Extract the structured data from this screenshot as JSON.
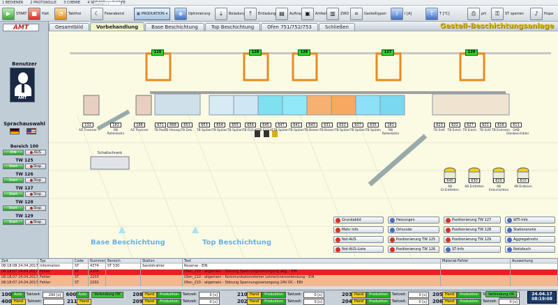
{
  "menu": [
    "1 BEDIENER",
    "2 PROTOKOLLE",
    "3 CHEMIE",
    "4 SERVICE",
    "5 HILFE"
  ],
  "search_placeholder": "Suchen / F",
  "toolbar": {
    "start": "START",
    "stop": "Halt",
    "takt": "Taktfrei",
    "feier": "Feierabend",
    "produktion": "PRODUKTION",
    "optim": "Optimierung",
    "belad": "Beladung",
    "entlad": "Entladung",
    "auftrag": "Auftrag",
    "artikel": "Artikel",
    "zwd": "ZWD",
    "gestell": "Gestelltypen",
    "ia": "I [A]",
    "tc": "T [°C]",
    "prt": "prt",
    "sperren": "ST sperren",
    "hupe": "Hupe"
  },
  "logo": "AMT",
  "tabs": [
    "Gesamtbild",
    "Vorbehandlung",
    "Base Beschichtung",
    "Top Beschichtung",
    "Ofen 751/752/753",
    "Schließen"
  ],
  "active_tab": "Vorbehandlung",
  "app_title": "Gestell-Beschichtungsanlage",
  "user": {
    "section": "Benutzer",
    "name": "AMT"
  },
  "lang": {
    "section": "Sprachauswahl"
  },
  "areas": [
    {
      "label": "Bereich 100",
      "a": "EIN",
      "b": "AUS"
    },
    {
      "label": "TW 125",
      "a": "Start",
      "b": "Stop"
    },
    {
      "label": "TW 126",
      "a": "Start",
      "b": "Stop"
    },
    {
      "label": "TW 127",
      "a": "Start",
      "b": "Stop"
    },
    {
      "label": "TW 128",
      "a": "Start",
      "b": "Stop"
    },
    {
      "label": "TW 129",
      "a": "Start",
      "b": "Stop"
    }
  ],
  "stations": [
    {
      "num": "132",
      "name": "AZ Trockner"
    },
    {
      "num": "182",
      "name": "RB Rollenbahn"
    },
    {
      "num": "188",
      "name": "AZ Trockner"
    },
    {
      "num": "671",
      "name": "TB Pass."
    },
    {
      "num": "668",
      "name": "TB Hexasp."
    },
    {
      "num": "651",
      "name": "TB Dek."
    },
    {
      "num": "653",
      "name": "TB Spülen"
    },
    {
      "num": "654",
      "name": "TB Spülen"
    },
    {
      "num": "655",
      "name": "TB Spülen"
    },
    {
      "num": "656",
      "name": "TB El.Entf."
    },
    {
      "num": "645",
      "name": "TB El.Entf."
    },
    {
      "num": "647",
      "name": "TB Spülen"
    },
    {
      "num": "641",
      "name": "TB Spülen"
    },
    {
      "num": "643",
      "name": "TB Beizen"
    },
    {
      "num": "631",
      "name": "TB Beizen"
    },
    {
      "num": "632",
      "name": "TB Spülen"
    },
    {
      "num": "637",
      "name": "TB Spülen"
    },
    {
      "num": "635",
      "name": "TB Spülen"
    },
    {
      "num": "181",
      "name": "RB Rollenbahn"
    },
    {
      "num": "623",
      "name": "TB Entf."
    },
    {
      "num": "622",
      "name": "TB Entch."
    },
    {
      "num": "627",
      "name": "TB Entch."
    },
    {
      "num": "621",
      "name": "TB Entf."
    },
    {
      "num": "616",
      "name": "TB Entrmen"
    },
    {
      "num": "611",
      "name": "OAB Glasbeschäder"
    }
  ],
  "cranes": [
    "125",
    "128",
    "126",
    "127",
    "129"
  ],
  "side_stations": [
    {
      "num": "640",
      "name": "AB El.Entfetten"
    },
    {
      "num": "630",
      "name": "AB Entfetten"
    },
    {
      "num": "620",
      "name": "AB Entschichten"
    },
    {
      "num": "610",
      "name": "AB Entbrien"
    }
  ],
  "schaltschrank": "Schaltschrank",
  "section_labels": [
    "Base Beschichtung",
    "Top Beschichtung"
  ],
  "controls": [
    {
      "label": "Grundabild"
    },
    {
      "label": "Heizungen"
    },
    {
      "label": "Positionierung TW 127"
    },
    {
      "label": "WTI-Info"
    },
    {
      "label": "Mehr Info"
    },
    {
      "label": "Ortscode"
    },
    {
      "label": "Positionierung TW 128"
    },
    {
      "label": "Stationsnotiz"
    },
    {
      "label": "Not-AUS"
    },
    {
      "label": "Positionierung TW 125"
    },
    {
      "label": "Positionierung TW 129"
    },
    {
      "label": "Aggregatnotiz"
    },
    {
      "label": "Not-AUS-Liste"
    },
    {
      "label": "Positionierung TW 126"
    },
    {
      "label": "ST-Info"
    },
    {
      "label": "Notizbuch"
    }
  ],
  "alarm_headers": [
    "Zeit",
    "Typ",
    "Code",
    "Nummer",
    "Bereich",
    "Station",
    "Text",
    "Material-Fehler",
    "Auswertung"
  ],
  "alarms": [
    {
      "zeit": "08:18:08 24.04.2017",
      "typ": "Information",
      "code": "ST",
      "nummer": "4374",
      "bereich": "ST 530",
      "station": "Sandstrahler",
      "text": "Reserve - EIN",
      "mat": "",
      "ausw": "",
      "bg": "#ffffff"
    },
    {
      "zeit": "08:18:07 24.04.2017",
      "typ": "Fehler",
      "code": "ST",
      "nummer": "2200",
      "bereich": "",
      "station": "",
      "text": "Ofen_210 - allgemein - Störung Spannungsversorgung allg. - EIN",
      "mat": "",
      "ausw": "",
      "bg": "#e82020"
    },
    {
      "zeit": "08:18:07 24.04.2017",
      "typ": "Fehler",
      "code": "ST",
      "nummer": "2203",
      "bereich": "",
      "station": "",
      "text": "Ofen_210 - allgemein - Kommunikationsfehler Leitrechnerverbindung - EIN",
      "mat": "",
      "ausw": "",
      "bg": "#f4b890"
    },
    {
      "zeit": "08:18:07 24.04.2017",
      "typ": "Fehler",
      "code": "ST",
      "nummer": "2202",
      "bereich": "",
      "station": "",
      "text": "Ofen_210 - allgemein - Störung Spannungsversorgung 24V DC - EIN",
      "mat": "",
      "ausw": "",
      "bg": "#f4b890"
    }
  ],
  "status_rows": [
    {
      "id": "100",
      "mode": "Auto",
      "takt_label": "Taktzeit:",
      "takt": "290 [s]",
      "n2": "600",
      "mode2": "Auto",
      "v": "Verbindung OK"
    },
    {
      "id": "400",
      "mode": "Hand",
      "takt_label": "Taktzeit:",
      "takt": "",
      "n2": "211",
      "mode2": "Hand",
      "v": ""
    }
  ],
  "status_groups": [
    {
      "n": "208",
      "m": "Hand",
      "p": "Produktion",
      "t": "Taktzeit:",
      "v": "0 [s]"
    },
    {
      "n": "209",
      "m": "Hand",
      "p": "Produktion",
      "t": "Taktzeit:",
      "v": "0 [s]"
    },
    {
      "n": "210",
      "m": "Hand",
      "p": "Produktion",
      "t": "Taktzeit:",
      "v": "0 [s]"
    },
    {
      "n": "202",
      "m": "Hand",
      "p": "Produktion",
      "t": "Taktzeit:",
      "v": "0 [s]"
    },
    {
      "n": "203",
      "m": "Hand",
      "p": "Produktion",
      "t": "Taktzeit:",
      "v": "0 [s]"
    },
    {
      "n": "204",
      "m": "Hand",
      "p": "Produktion",
      "t": "Taktzeit:",
      "v": "0 [s]"
    },
    {
      "n": "205",
      "m": "Hand",
      "p": "Produktion",
      "t": "Taktzeit:",
      "v": "0 [s]"
    },
    {
      "n": "206",
      "m": "Hand",
      "p": "Produktion",
      "t": "Taktzeit:",
      "v": "0 [s]"
    }
  ],
  "verbindung": [
    "Verbindung OK",
    "Verbindung OK"
  ],
  "clock": {
    "date": "24.04.17",
    "time": "08:19:08"
  },
  "colors": {
    "accent": "#e0c020",
    "alarm_red": "#e82020",
    "alarm_orange": "#f4b890",
    "crane_orange": "#e88a20"
  }
}
